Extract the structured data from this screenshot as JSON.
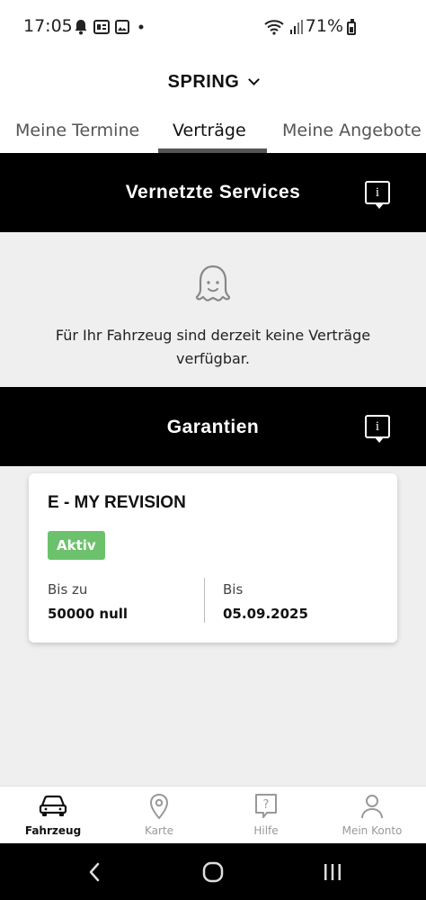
{
  "status_bar": {
    "time": "17:05",
    "battery": "71%",
    "left_icons": [
      "bell-icon",
      "gb-icon",
      "image-icon",
      "dot-icon"
    ],
    "right_icons": [
      "wifi-icon",
      "signal-icon",
      "battery-icon"
    ]
  },
  "vehicle_selector": {
    "name": "SPRING"
  },
  "tabs": [
    {
      "label": "Meine Termine",
      "active": false
    },
    {
      "label": "Verträge",
      "active": true
    },
    {
      "label": "Meine Angebote",
      "active": false
    }
  ],
  "sections": {
    "connected_services": {
      "title": "Vernetzte Services",
      "info_label": "i",
      "empty_message": "Für Ihr Fahrzeug sind derzeit keine Verträge verfügbar."
    },
    "warranties": {
      "title": "Garantien",
      "info_label": "i",
      "card": {
        "title": "E - MY REVISION",
        "status": "Aktiv",
        "status_color": "#6cc26c",
        "left_label": "Bis zu",
        "left_value": "50000 null",
        "right_label": "Bis",
        "right_value": "05.09.2025"
      }
    }
  },
  "bottom_nav": [
    {
      "label": "Fahrzeug",
      "icon": "car-icon",
      "active": true
    },
    {
      "label": "Karte",
      "icon": "map-pin-icon",
      "active": false
    },
    {
      "label": "Hilfe",
      "icon": "help-icon",
      "active": false
    },
    {
      "label": "Mein Konto",
      "icon": "account-icon",
      "active": false
    }
  ],
  "system_nav": [
    "back-icon",
    "home-icon",
    "recents-icon"
  ]
}
